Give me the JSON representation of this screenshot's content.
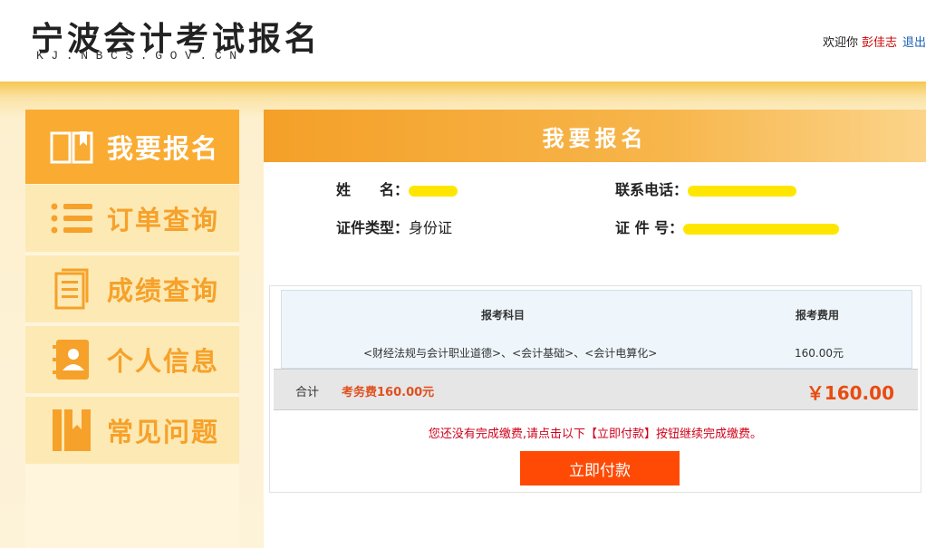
{
  "header": {
    "logo_title": "宁波会计考试报名",
    "logo_sub": "KJ.NBCS.GOV.CN",
    "welcome": "欢迎你",
    "user_name": "彭佳志",
    "logout": "退出"
  },
  "sidebar": {
    "items": [
      {
        "label": "我要报名",
        "icon": "book-icon",
        "active": true
      },
      {
        "label": "订单查询",
        "icon": "list-icon",
        "active": false
      },
      {
        "label": "成绩查询",
        "icon": "document-icon",
        "active": false
      },
      {
        "label": "个人信息",
        "icon": "contact-book-icon",
        "active": false
      },
      {
        "label": "常见问题",
        "icon": "bookmark-icon",
        "active": false
      }
    ]
  },
  "main": {
    "title": "我要报名",
    "info": {
      "name_label": "姓　　名：",
      "name_value": "",
      "phone_label": "联系电话：",
      "phone_value": "",
      "id_type_label": "证件类型：",
      "id_type_value": "身份证",
      "id_no_label": "证 件 号：",
      "id_no_value": ""
    },
    "table": {
      "headers": [
        "报考科目",
        "报考费用"
      ],
      "rows": [
        {
          "subjects": "<财经法规与会计职业道德>、<会计基础>、<会计电算化>",
          "fee": "160.00元"
        }
      ]
    },
    "total": {
      "label": "合计",
      "fee_text": "考务费160.00元",
      "amount": "￥160.00"
    },
    "notice": "您还没有完成缴费,请点击以下【立即付款】按钮继续完成缴费。",
    "pay_button": "立即付款"
  },
  "colors": {
    "accent": "#f9ab32",
    "pay_button": "#ff4a06",
    "price": "#e84c10",
    "notice": "#d0021b"
  }
}
